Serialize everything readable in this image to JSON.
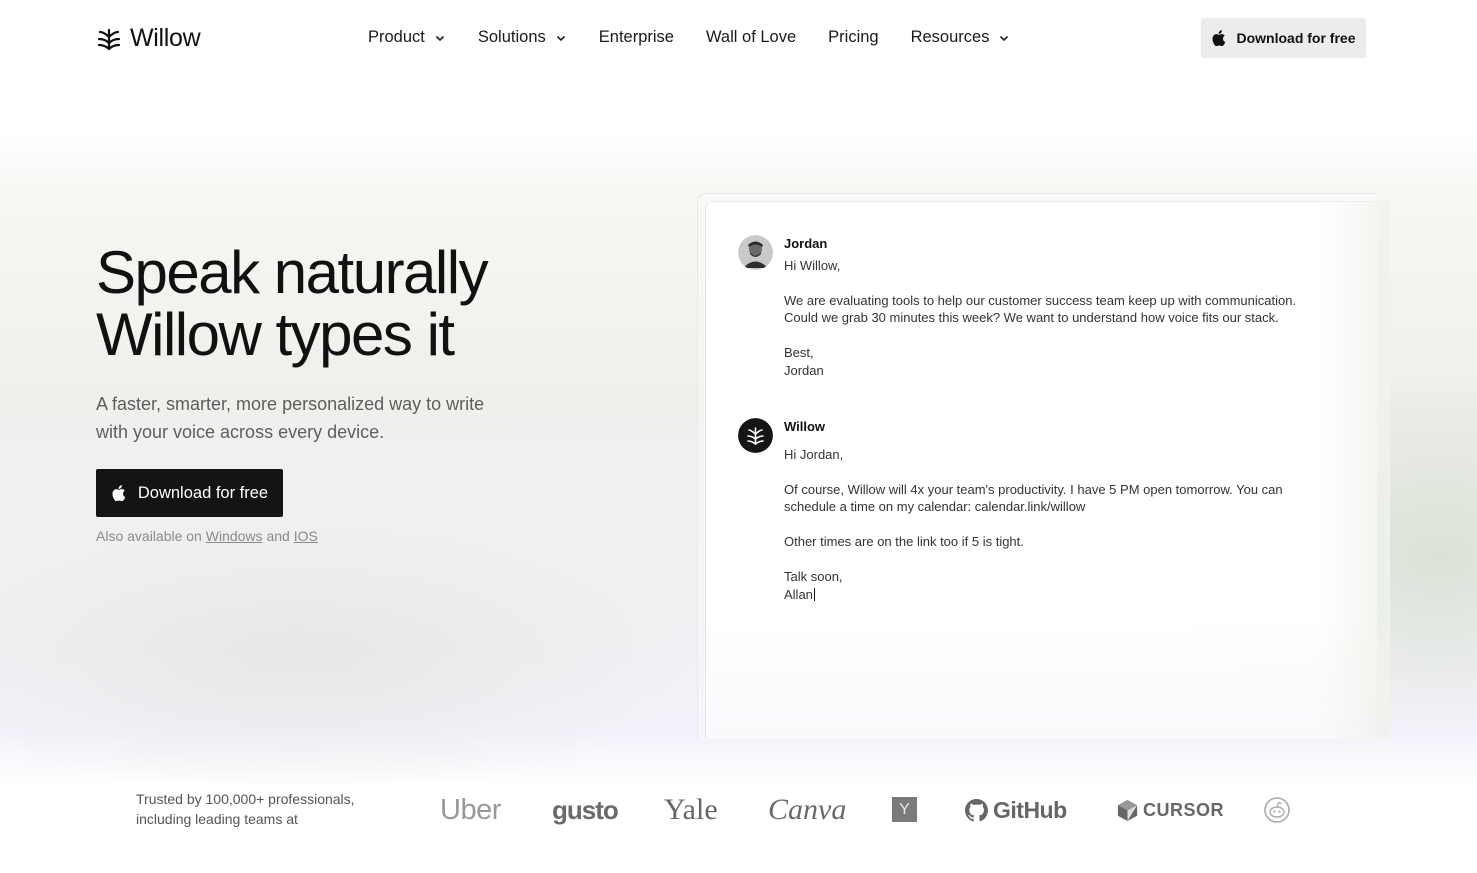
{
  "nav": {
    "logo_text": "Willow",
    "menu": [
      {
        "label": "Product",
        "has_dropdown": true
      },
      {
        "label": "Solutions",
        "has_dropdown": true
      },
      {
        "label": "Enterprise",
        "has_dropdown": false
      },
      {
        "label": "Wall of Love",
        "has_dropdown": false
      },
      {
        "label": "Pricing",
        "has_dropdown": false
      },
      {
        "label": "Resources",
        "has_dropdown": true
      }
    ],
    "cta_label": "Download for free"
  },
  "hero": {
    "headline_line1": "Speak naturally",
    "headline_line2": "Willow types it",
    "subtext": "A faster, smarter, more personalized way to write with your voice across every device.",
    "cta_label": "Download for free",
    "also_prefix": "Also available on",
    "also_windows": "Windows",
    "also_and": "and",
    "also_ios": "IOS"
  },
  "conversation": {
    "incoming": {
      "sender": "Jordan",
      "greeting": "Hi Willow,",
      "body": "We are evaluating tools to help our customer success team keep up with communication. Could we grab 30 minutes this week? We want to understand how voice fits our stack.",
      "signoff": "Best,",
      "signature": "Jordan"
    },
    "reply": {
      "sender": "Willow",
      "greeting": "Hi Jordan,",
      "body": "Of course, Willow will 4x your team's productivity. I have 5 PM open tomorrow. You can schedule a time on my calendar: calendar.link/willow",
      "body2": "Other times are on the link too if 5 is tight.",
      "signoff": "Talk soon,",
      "signature": "Allan"
    }
  },
  "trust": {
    "text": "Trusted by 100,000+ professionals, including leading teams at",
    "logos": [
      "Uber",
      "gusto",
      "Yale",
      "Canva",
      "Y",
      "GitHub",
      "CURSOR"
    ]
  },
  "colors": {
    "primary_button": "#141414",
    "nav_button": "#ececec",
    "text_muted": "#5e5e5e"
  }
}
